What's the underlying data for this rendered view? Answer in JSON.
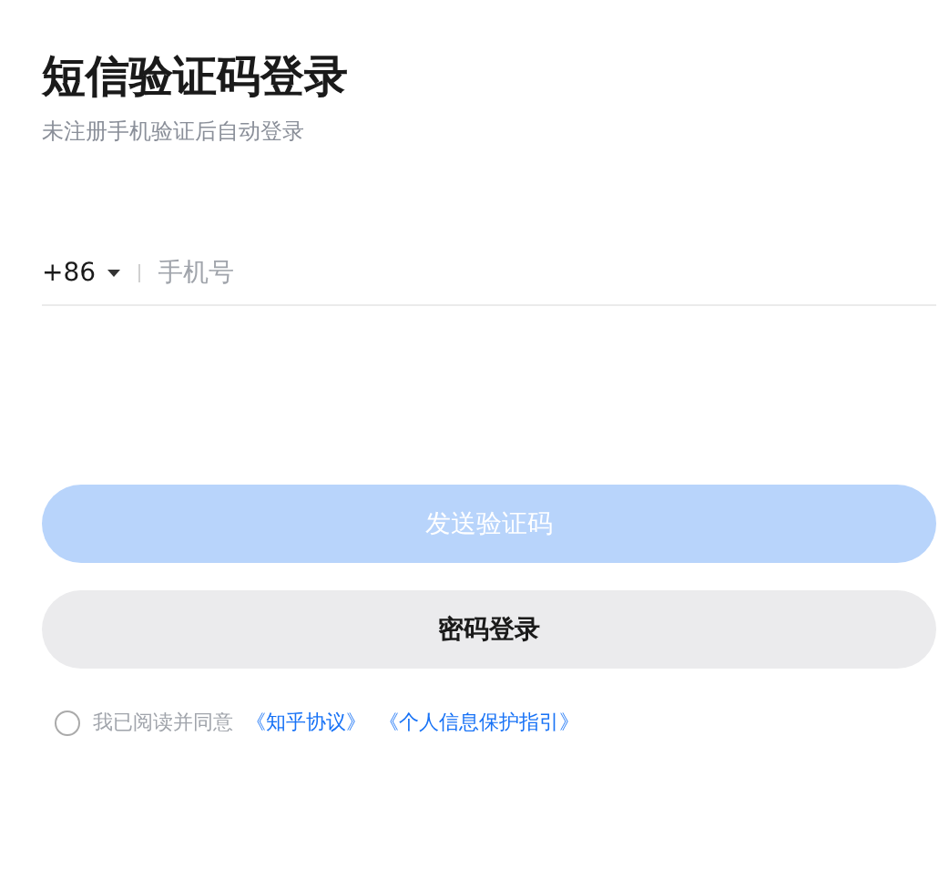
{
  "title": "短信验证码登录",
  "subtitle": "未注册手机验证后自动登录",
  "phone": {
    "country_code": "+86",
    "placeholder": "手机号"
  },
  "send_button": {
    "label": "发送验证码",
    "disabled": true
  },
  "password_button": {
    "label": "密码登录"
  },
  "agreement": {
    "checked": false,
    "text": "我已阅读并同意",
    "links": [
      "《知乎协议》",
      "《个人信息保护指引》"
    ]
  }
}
